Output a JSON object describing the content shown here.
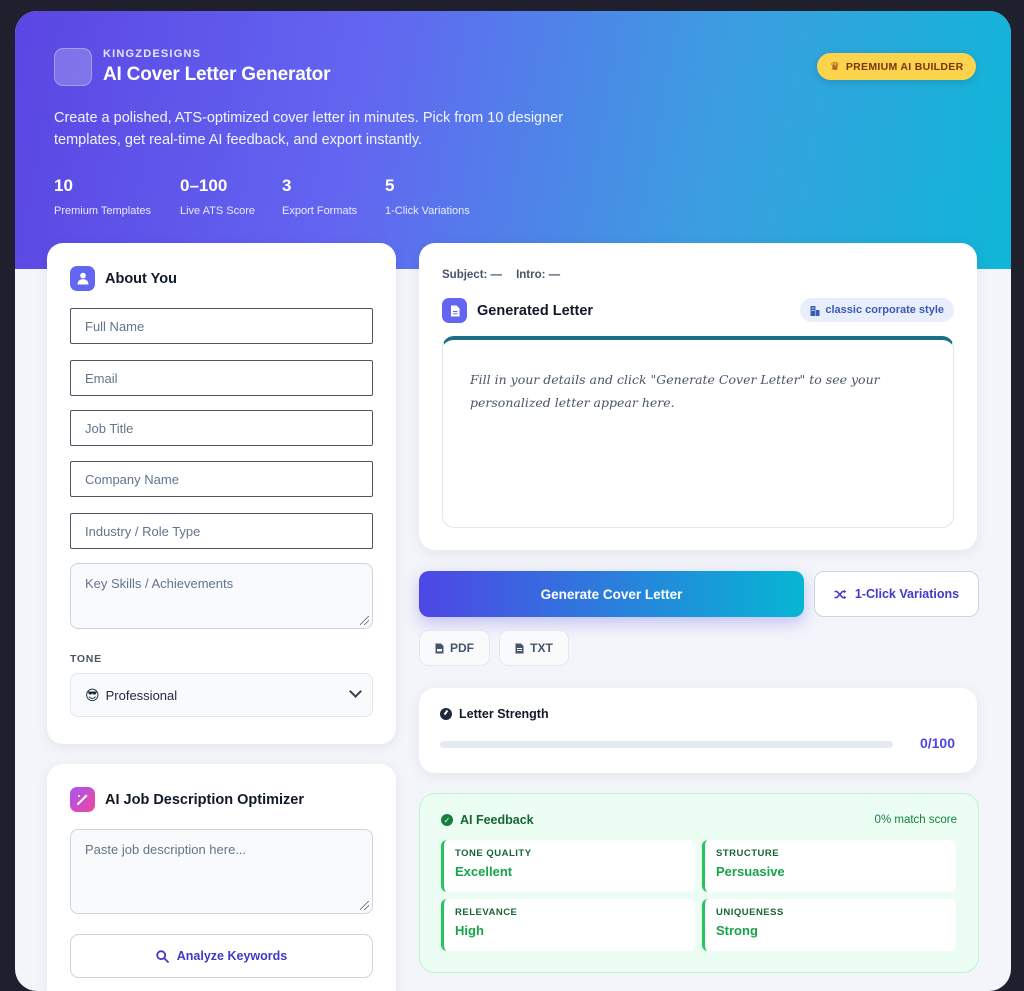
{
  "header": {
    "brand": "KINGZDESIGNS",
    "title": "AI Cover Letter Generator",
    "badge": "PREMIUM AI BUILDER",
    "description": "Create a polished, ATS-optimized cover letter in minutes. Pick from 10 designer templates, get real-time AI feedback, and export instantly.",
    "stats": [
      {
        "value": "10",
        "label": "Premium Templates"
      },
      {
        "value": "0–100",
        "label": "Live ATS Score"
      },
      {
        "value": "3",
        "label": "Export Formats"
      },
      {
        "value": "5",
        "label": "1-Click Variations"
      }
    ]
  },
  "about": {
    "title": "About You",
    "fields": {
      "full_name": "Full Name",
      "email": "Email",
      "job_title": "Job Title",
      "company": "Company Name",
      "industry": "Industry / Role Type",
      "skills": "Key Skills / Achievements"
    },
    "tone_label": "TONE",
    "tone_emoji": "😎",
    "tone_value": "Professional"
  },
  "optimizer": {
    "title": "AI Job Description Optimizer",
    "placeholder": "Paste job description here...",
    "analyze_label": "Analyze Keywords"
  },
  "letter": {
    "subject_label": "Subject: —",
    "intro_label": "Intro: —",
    "title": "Generated Letter",
    "style_chip": "classic corporate style",
    "placeholder": "Fill in your details and click \"Generate Cover Letter\" to see your personalized letter appear here."
  },
  "actions": {
    "generate": "Generate Cover Letter",
    "variations": "1-Click Variations",
    "pdf": "PDF",
    "txt": "TXT"
  },
  "strength": {
    "title": "Letter Strength",
    "score": "0/100",
    "progress": 0
  },
  "feedback": {
    "title": "AI Feedback",
    "match": "0% match score",
    "items": [
      {
        "key": "TONE QUALITY",
        "value": "Excellent"
      },
      {
        "key": "STRUCTURE",
        "value": "Persuasive"
      },
      {
        "key": "RELEVANCE",
        "value": "High"
      },
      {
        "key": "UNIQUENESS",
        "value": "Strong"
      }
    ]
  },
  "icons": {
    "user": "user-icon",
    "wand": "magic-wand-icon",
    "document": "document-icon",
    "crown": "crown-icon",
    "shuffle": "shuffle-icon",
    "gauge": "gauge-icon",
    "check": "check-circle-icon",
    "search": "search-icon"
  },
  "colors": {
    "primary": "#4f46e5",
    "accent": "#06b6d4",
    "success": "#16a34a",
    "badge": "#fcd34d"
  }
}
